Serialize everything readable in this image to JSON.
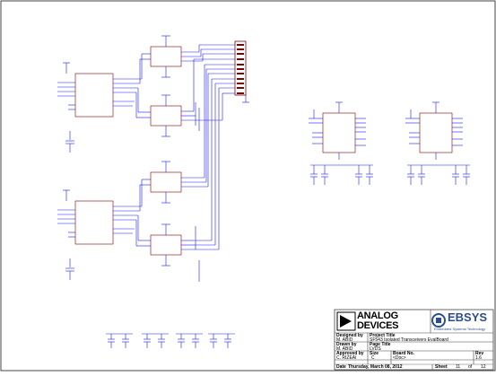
{
  "title_block": {
    "company_adi_line1": "ANALOG",
    "company_adi_line2": "DEVICES",
    "partner_name": "EBSYS",
    "partner_tagline": "Embedded Systems Technology",
    "designed_by_label": "Designed by",
    "designed_by_value": "M. ABID",
    "drawn_by_label": "Drawn by",
    "drawn_by_value": "M. ABID",
    "approved_by_label": "Approved by",
    "approved_by_value": "C. RIZEAI",
    "project_title_label": "Project Title",
    "project_title_value": "SF543 Isolated Transceivers EvalBoard",
    "page_title_label": "Page Title",
    "page_title_value": "LVDS",
    "size_label": "Size",
    "size_value": "C",
    "board_no_label": "Board No.",
    "board_no_value": "<Doc>",
    "rev_label": "Rev",
    "rev_value": "1.6",
    "date_label": "Date",
    "date_value": "Thursday, March 08, 2012",
    "sheet_label": "Sheet",
    "sheet_number": "11",
    "sheet_of": "of",
    "sheet_total": "12"
  },
  "colors": {
    "wire": "#1a1aff",
    "component": "#800000",
    "net_label": "#cc0000",
    "frame": "#444444",
    "ebsys_blue": "#2c4f8a"
  }
}
